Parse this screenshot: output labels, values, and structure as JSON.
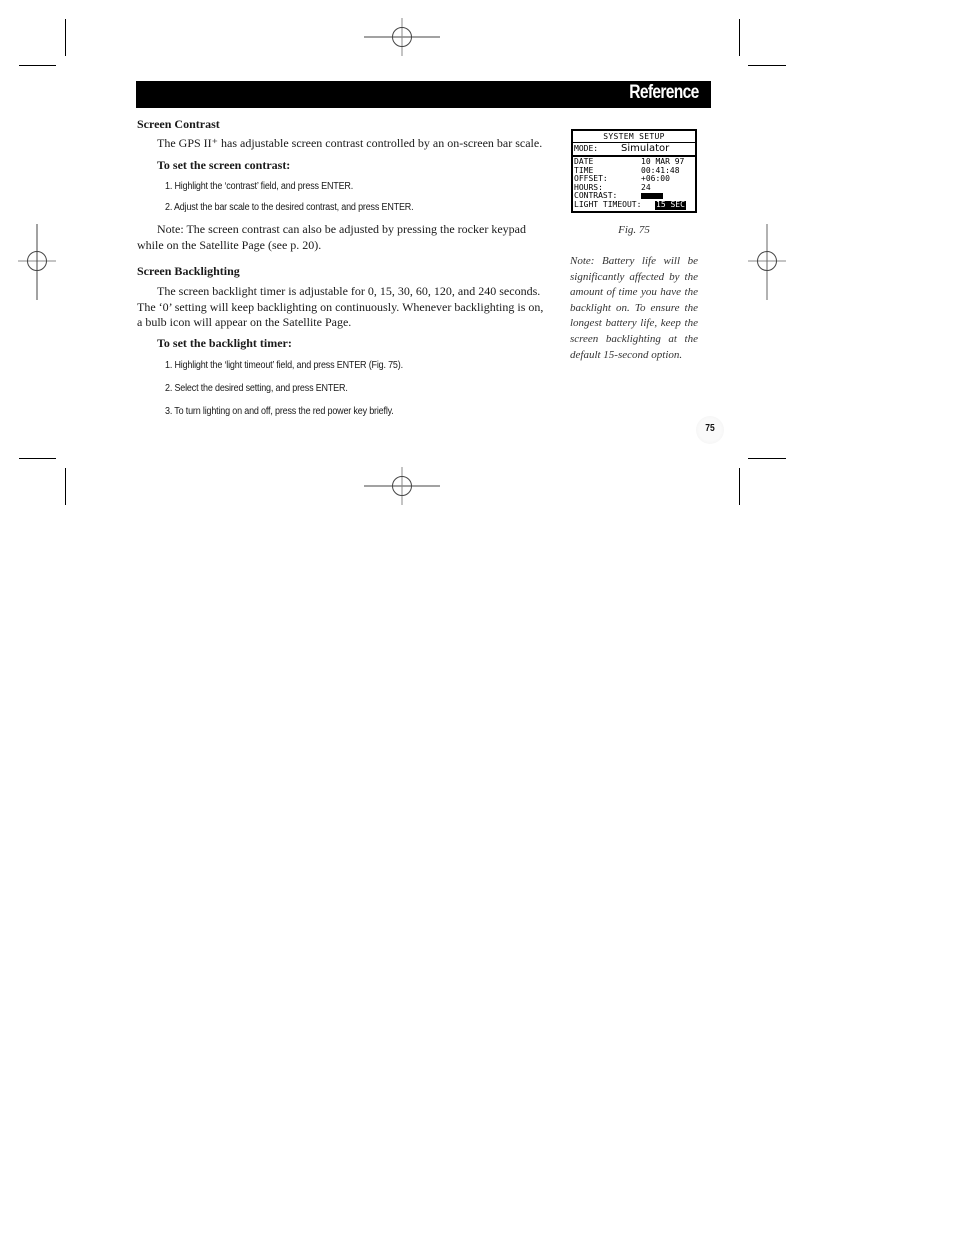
{
  "header": {
    "title": "Reference"
  },
  "sections": [
    {
      "heading": "Screen Contrast",
      "intro": "The GPS II⁺ has adjustable screen contrast controlled by an on-screen bar scale.",
      "subheading": "To set the screen contrast:",
      "steps": [
        "1. Highlight the ‘contrast’ field, and press ENTER.",
        "2. Adjust the bar scale to the desired contrast, and press ENTER."
      ],
      "note": "Note: The screen contrast can also be adjusted by pressing the rocker keypad while on the Satellite Page (see p. 20)."
    },
    {
      "heading": "Screen Backlighting",
      "intro": "The screen backlight timer is adjustable for 0, 15, 30, 60, 120, and 240 seconds. The ‘0’ setting will keep backlighting on continuously. Whenever backlighting is on, a bulb icon will appear on the Satellite Page.",
      "subheading": "To set the backlight timer:",
      "steps": [
        "1. Highlight the ‘light timeout’ field, and press ENTER (Fig. 75).",
        "2. Select the desired setting, and press ENTER.",
        "3. To turn lighting on and off, press the red power key briefly."
      ]
    }
  ],
  "figure": {
    "screen_title": "SYSTEM SETUP",
    "mode_label": "MODE:",
    "mode_value": "Simulator",
    "rows": [
      {
        "label": "DATE",
        "value": "10 MAR 97"
      },
      {
        "label": "TIME",
        "value": "00:41:48"
      },
      {
        "label": "OFFSET:",
        "value": "+06:00"
      },
      {
        "label": "HOURS:",
        "value": "24"
      },
      {
        "label": "CONTRAST:",
        "value": ""
      }
    ],
    "light_timeout_label": "LIGHT TIMEOUT:",
    "light_timeout_value": "15 SEC",
    "caption": "Fig. 75"
  },
  "side_note": "Note: Battery life will be significantly affected by the amount of time you have the backlight on. To ensure the longest battery life, keep the screen backlighting at the default 15-second option.",
  "page_number": "75"
}
